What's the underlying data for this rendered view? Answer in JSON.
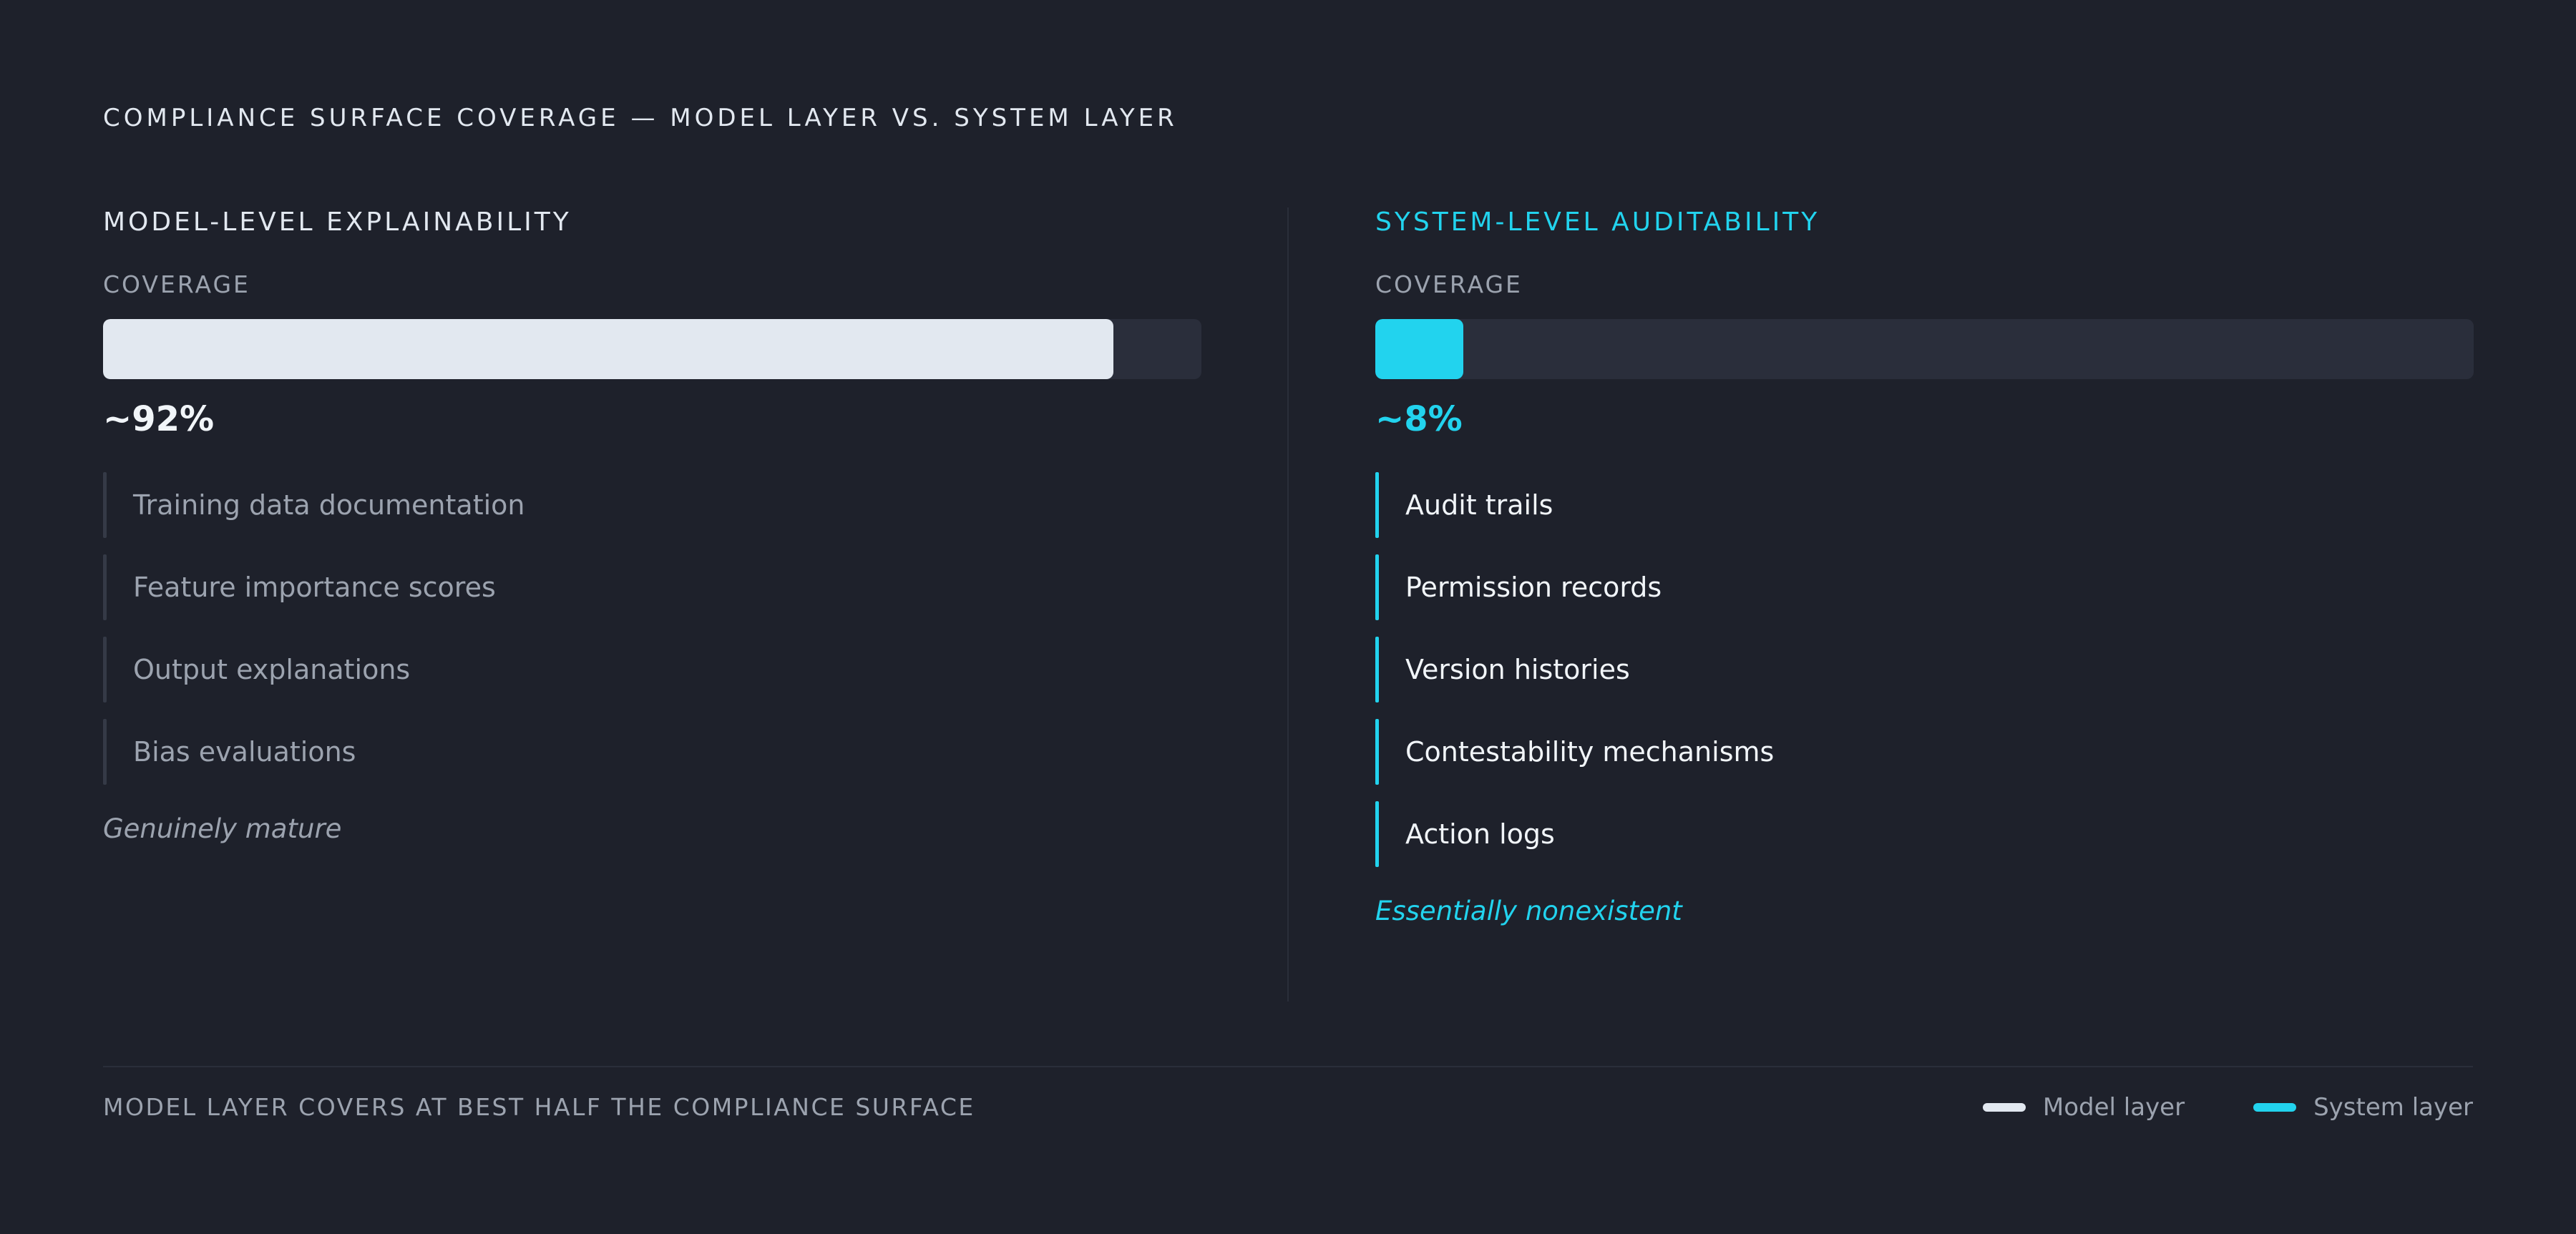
{
  "title": "COMPLIANCE SURFACE COVERAGE — MODEL LAYER VS. SYSTEM LAYER",
  "colors": {
    "model_accent": "#e2e8f0",
    "system_accent": "#22d3ee",
    "background": "#1e212b",
    "track": "#2a2e3b"
  },
  "model": {
    "heading": "MODEL-LEVEL EXPLAINABILITY",
    "coverage_label": "COVERAGE",
    "coverage_value": 92,
    "coverage_text": "~92%",
    "items": [
      "Training data documentation",
      "Feature importance scores",
      "Output explanations",
      "Bias evaluations"
    ],
    "verdict": "Genuinely mature"
  },
  "system": {
    "heading": "SYSTEM-LEVEL AUDITABILITY",
    "coverage_label": "COVERAGE",
    "coverage_value": 8,
    "coverage_text": "~8%",
    "items": [
      "Audit trails",
      "Permission records",
      "Version histories",
      "Contestability mechanisms",
      "Action logs"
    ],
    "verdict": "Essentially nonexistent"
  },
  "footer": {
    "note": "MODEL LAYER COVERS AT BEST HALF THE COMPLIANCE SURFACE",
    "legend": [
      {
        "label": "Model layer",
        "color": "#e2e8f0"
      },
      {
        "label": "System layer",
        "color": "#22d3ee"
      }
    ]
  }
}
